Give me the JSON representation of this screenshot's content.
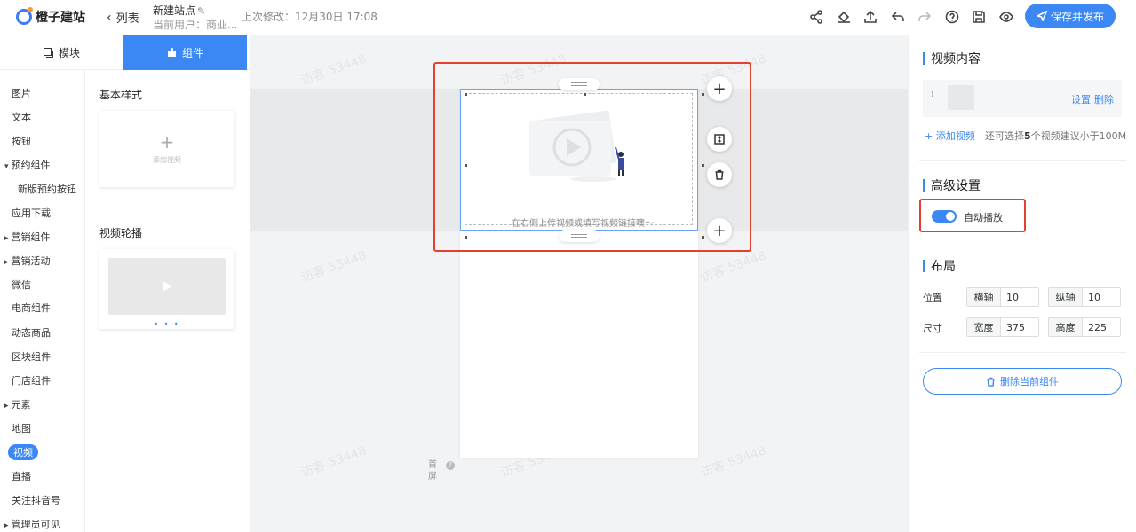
{
  "header": {
    "logo_text": "橙子建站",
    "back_label": "列表",
    "site_name": "新建站点",
    "current_user": "当前用户：商业...",
    "last_edit": "上次修改：12月30日 17:08",
    "save_publish_label": "保存并发布",
    "tools": [
      "share-icon",
      "paint-bucket-icon",
      "upload-icon",
      "undo-icon",
      "redo-icon",
      "help-icon",
      "save-icon",
      "preview-eye-icon"
    ]
  },
  "left_tabs": {
    "modules_label": "模块",
    "components_label": "组件"
  },
  "categories": [
    {
      "label": "图片",
      "kind": "item"
    },
    {
      "label": "文本",
      "kind": "item"
    },
    {
      "label": "按钮",
      "kind": "item"
    },
    {
      "label": "预约组件",
      "kind": "group-open"
    },
    {
      "label": "新版预约按钮",
      "kind": "sub"
    },
    {
      "label": "应用下载",
      "kind": "item"
    },
    {
      "label": "营销组件",
      "kind": "group"
    },
    {
      "label": "营销活动",
      "kind": "group"
    },
    {
      "label": "微信",
      "kind": "item"
    },
    {
      "label": "电商组件",
      "kind": "item"
    },
    {
      "label": "动态商品",
      "kind": "item"
    },
    {
      "label": "区块组件",
      "kind": "item"
    },
    {
      "label": "门店组件",
      "kind": "item"
    },
    {
      "label": "元素",
      "kind": "group"
    },
    {
      "label": "地图",
      "kind": "item"
    },
    {
      "label": "视频",
      "kind": "active"
    },
    {
      "label": "直播",
      "kind": "item"
    },
    {
      "label": "关注抖音号",
      "kind": "item"
    },
    {
      "label": "管理员可见",
      "kind": "group"
    }
  ],
  "component_panel": {
    "basic_title": "基本样式",
    "add_video_label": "添加视频",
    "carousel_title": "视频轮播"
  },
  "canvas": {
    "video_hint": "在右侧上传视频或填写视频链接噢～",
    "home_screen_label": "首屏",
    "watermark": "访客 53448"
  },
  "right_panel": {
    "video_content_title": "视频内容",
    "settings_label": "设置",
    "delete_label": "删除",
    "add_video_label": "添加视频",
    "add_note_prefix": "还可选择",
    "add_note_count": "5",
    "add_note_suffix": "个视频建议小于100M",
    "advanced_title": "高级设置",
    "autoplay_label": "自动播放",
    "autoplay_on": true,
    "layout_title": "布局",
    "position_label": "位置",
    "x_label": "横轴",
    "x_value": "10",
    "y_label": "纵轴",
    "y_value": "10",
    "size_label": "尺寸",
    "width_label": "宽度",
    "width_value": "375",
    "height_label": "高度",
    "height_value": "225",
    "delete_component_label": "删除当前组件"
  },
  "colors": {
    "accent": "#3b88f5",
    "highlight": "#e2412f"
  }
}
